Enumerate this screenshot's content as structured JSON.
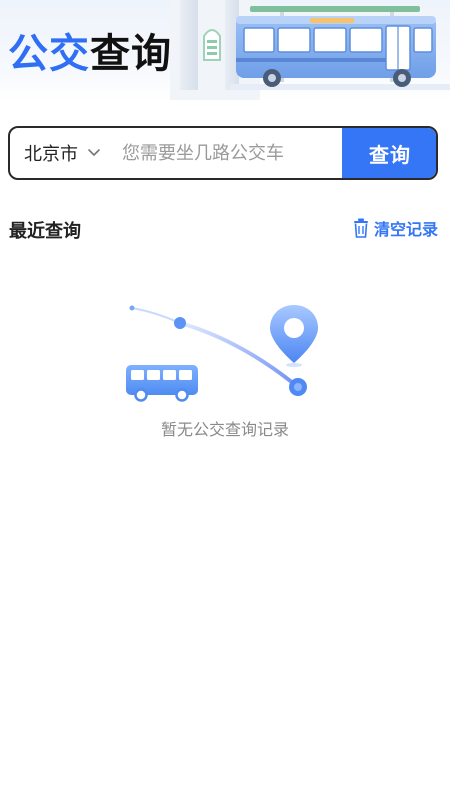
{
  "header": {
    "title_highlight": "公交",
    "title_rest": "查询"
  },
  "search": {
    "city": "北京市",
    "placeholder": "您需要坐几路公交车",
    "button_label": "查询"
  },
  "recent": {
    "title": "最近查询",
    "clear_label": "清空记录",
    "empty_text": "暂无公交查询记录"
  },
  "colors": {
    "accent": "#3476f6",
    "title_blue": "#2f6ef5",
    "text_dark": "#222222",
    "text_muted": "#8a8a8a"
  },
  "icons": {
    "city_dropdown": "chevron-down-icon",
    "clear": "trash-icon",
    "header_art": "bus-station-illustration",
    "empty_art": "bus-route-illustration"
  }
}
